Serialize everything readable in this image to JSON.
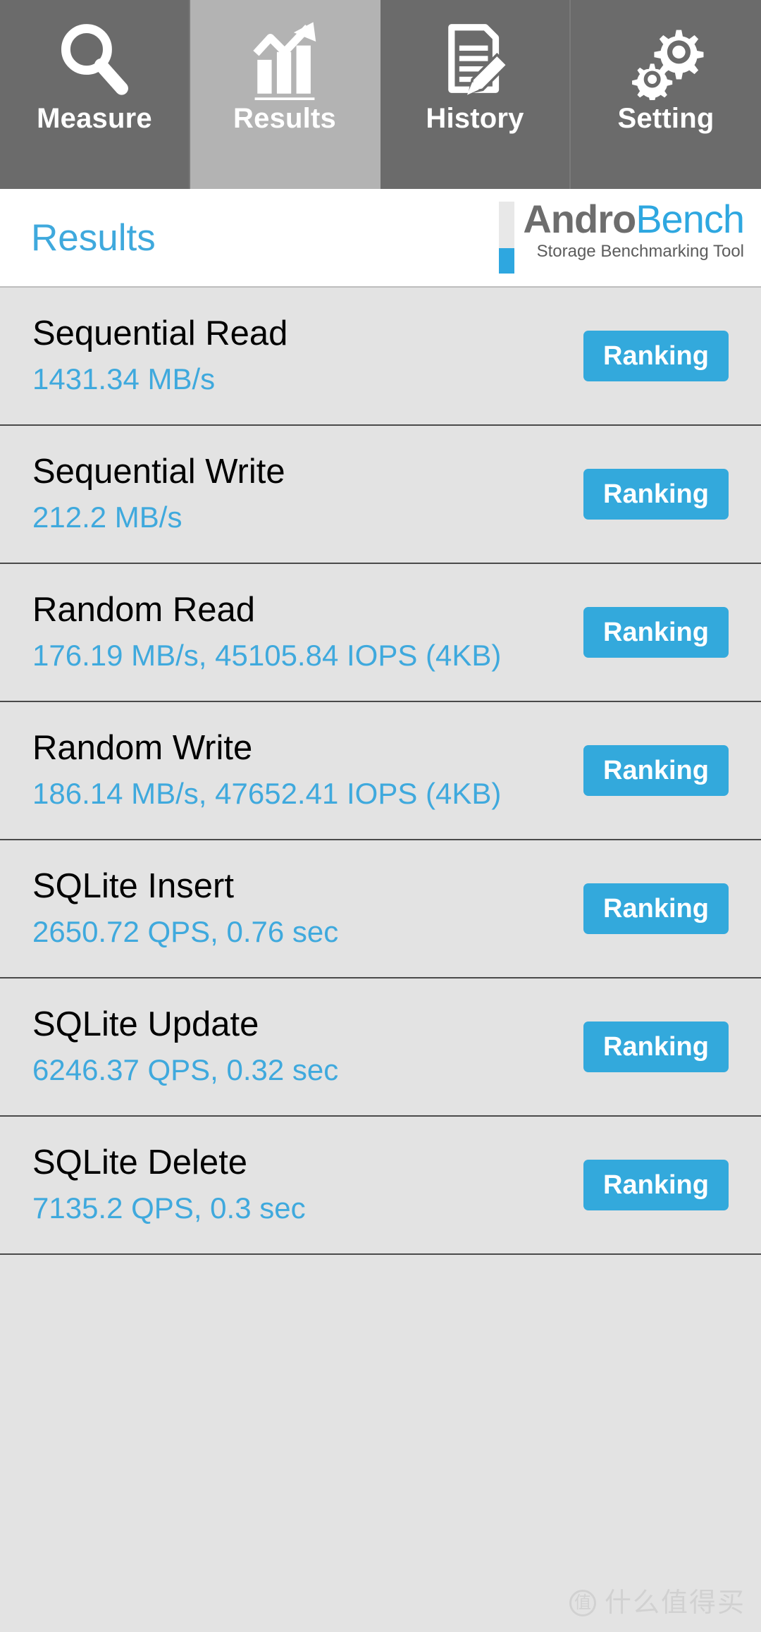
{
  "tabs": [
    {
      "id": "measure",
      "label": "Measure",
      "icon": "magnifier-icon",
      "active": false
    },
    {
      "id": "results",
      "label": "Results",
      "icon": "bar-chart-icon",
      "active": true
    },
    {
      "id": "history",
      "label": "History",
      "icon": "document-pencil-icon",
      "active": false
    },
    {
      "id": "setting",
      "label": "Setting",
      "icon": "gears-icon",
      "active": false
    }
  ],
  "header": {
    "title": "Results",
    "logo": {
      "name_part1": "Andro",
      "name_part2": "Bench",
      "tagline": "Storage Benchmarking Tool"
    }
  },
  "results": {
    "ranking_label": "Ranking",
    "rows": [
      {
        "name": "Sequential Read",
        "value": "1431.34 MB/s"
      },
      {
        "name": "Sequential Write",
        "value": "212.2 MB/s"
      },
      {
        "name": "Random Read",
        "value": "176.19 MB/s, 45105.84 IOPS (4KB)"
      },
      {
        "name": "Random Write",
        "value": "186.14 MB/s, 47652.41 IOPS (4KB)"
      },
      {
        "name": "SQLite Insert",
        "value": "2650.72 QPS, 0.76 sec"
      },
      {
        "name": "SQLite Update",
        "value": "6246.37 QPS, 0.32 sec"
      },
      {
        "name": "SQLite Delete",
        "value": "7135.2 QPS, 0.3 sec"
      }
    ]
  },
  "watermark": {
    "badge": "值",
    "text": "什么值得买"
  },
  "colors": {
    "accent_blue": "#33a9dc",
    "title_blue": "#3fa9dd",
    "tabbar_gray": "#6b6b6b",
    "tab_active_gray": "#b3b3b3",
    "list_gray": "#e3e3e3",
    "logo_gray": "#6d6d6d"
  }
}
